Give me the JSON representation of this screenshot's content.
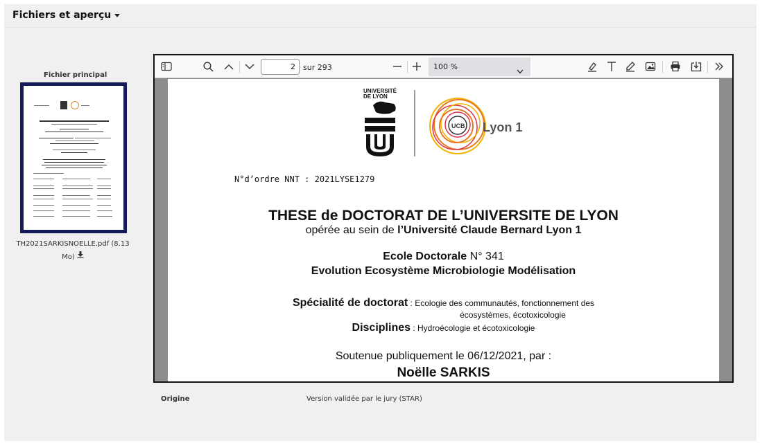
{
  "panel": {
    "title": "Fichiers et aperçu"
  },
  "sidebar": {
    "main_label": "Fichier principal",
    "file_name": "TH2021SARKISNOELLE.pdf (8.13",
    "file_size": "Mo)"
  },
  "viewer": {
    "page_number": "2",
    "page_total": "sur 293",
    "zoom": "100 %",
    "icons": [
      "sidebar-toggle-icon",
      "search-icon",
      "chevron-up-icon",
      "chevron-down-icon",
      "minus-icon",
      "plus-icon",
      "highlight-icon",
      "text-icon",
      "draw-icon",
      "image-icon",
      "print-icon",
      "save-icon",
      "double-chevron-right-icon"
    ]
  },
  "document": {
    "logo_left_line1": "UNIVERSITÉ",
    "logo_left_line2": "DE LYON",
    "logo_right_text": "Lyon 1",
    "logo_badge": "UCB",
    "nnt": "N°d’ordre NNT : 2021LYSE1279",
    "title": "THESE de DOCTORAT DE L’UNIVERSITE DE LYON",
    "subtitle_prefix": "opérée au sein de ",
    "subtitle_bold": "l’Université Claude Bernard Lyon 1",
    "ecole_bold": "Ecole Doctorale",
    "ecole_num": " N° 341",
    "evolution": "Evolution Ecosystème Microbiologie Modélisation",
    "specialite_bold": "Spécialité de doctorat",
    "specialite_text": " : Ecologie des communautés, fonctionnement des",
    "specialite_text2": "écosystèmes, écotoxicologie",
    "disciplines_bold": "Disciplines",
    "disciplines_text": " : Hydroécologie et écotoxicologie",
    "soutenue": "Soutenue publiquement le 06/12/2021, par :",
    "author": "Noëlle SARKIS"
  },
  "origin": {
    "label": "Origine",
    "value": "Version validée par le jury (STAR)"
  },
  "colors": {
    "frame": "#141a5a",
    "toolbar": "#f9f9fa",
    "page_bg": "#8d8d8d",
    "panel": "#f0f0f0"
  }
}
